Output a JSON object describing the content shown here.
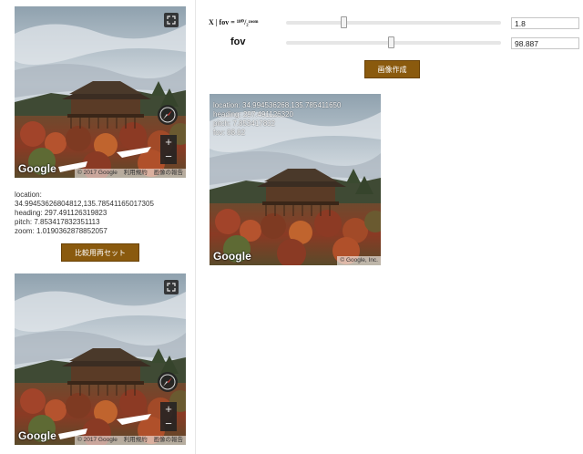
{
  "streetview": {
    "google_logo": "Google",
    "copyright": "© 2017 Google",
    "terms": "利用規約",
    "report": "画像の報告",
    "zoom_in": "+",
    "zoom_out": "−"
  },
  "info": {
    "location": "location:",
    "location_value": "34.99453626804812,135.78541165017305",
    "heading": "heading: 297.491126319823",
    "pitch": "pitch: 7.853417832351113",
    "zoom": "zoom: 1.0190362878852057"
  },
  "buttons": {
    "reset": "比較用再セット",
    "generate": "画像作成"
  },
  "controls": {
    "formula": "X | fov = ¹⁸⁰/₂ᶻᵒᵒᵐ",
    "fov_label": "fov",
    "zoom_value": "1.8",
    "fov_value": "98.887",
    "zoom_slider_fraction": 0.26,
    "fov_slider_fraction": 0.49
  },
  "result": {
    "location": "location: 34.994536268,135.785411650",
    "heading": "heading: 297.491126320",
    "pitch": "pitch: 7.853417832",
    "fov": "fov: 88.82",
    "google_logo": "Google",
    "copyright": "© Google, Inc."
  },
  "icons": [
    "fullscreen-icon",
    "compass-icon",
    "street-arrow-icon"
  ],
  "colors": {
    "button": "#8a5a0e",
    "sky": "#c8d2da",
    "foliage": "#8a3a24"
  }
}
